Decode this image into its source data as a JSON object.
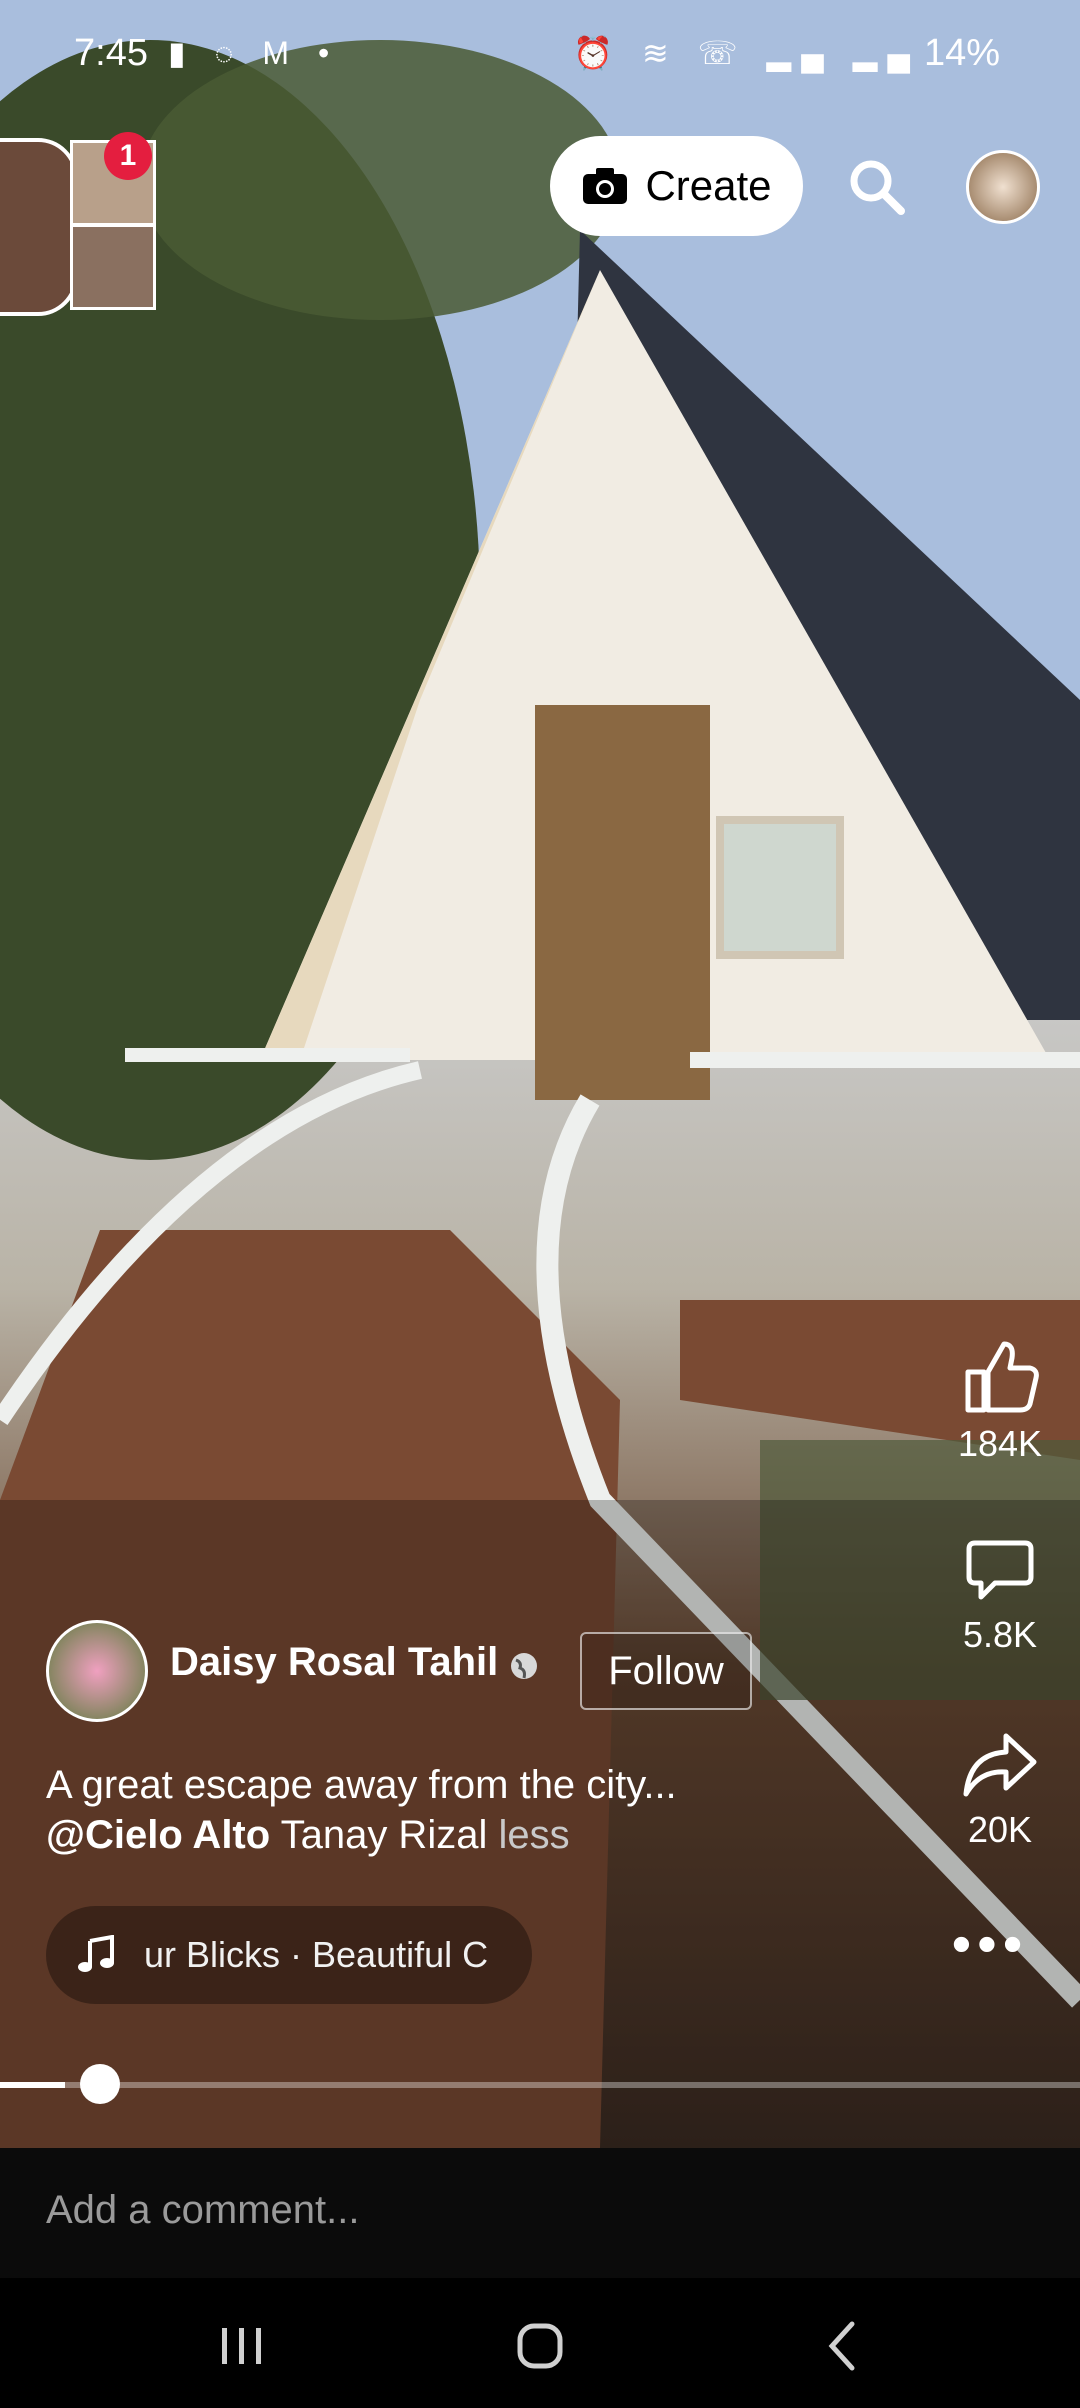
{
  "status_bar": {
    "time": "7:45",
    "left_icons": [
      "alert-icon",
      "whatsapp-icon",
      "gmail-icon",
      "dot-icon"
    ],
    "right_icons": [
      "alarm-icon",
      "wifi-icon",
      "call-icon",
      "signal-icon",
      "signal-icon"
    ],
    "battery": "14%"
  },
  "top_bar": {
    "notification_count": "1",
    "create_label": "Create"
  },
  "post": {
    "author_name": "Daisy Rosal Tahil",
    "follow_label": "Follow",
    "caption_line1": "A great escape away from the city...",
    "mention": "@Cielo Alto",
    "caption_line2_rest": " Tanay Rizal ",
    "less_label": "less",
    "music_text": "ur Blicks · Beautiful C",
    "progress": 0.06
  },
  "actions": {
    "like_count": "184K",
    "comment_count": "5.8K",
    "share_count": "20K"
  },
  "comment_bar": {
    "placeholder": "Add a comment..."
  },
  "colors": {
    "badge": "#e41e3f",
    "comment_bar_bg": "#0b0b0b"
  }
}
